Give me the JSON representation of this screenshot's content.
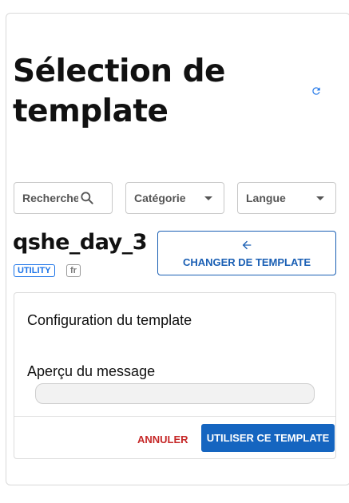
{
  "header": {
    "title": "Sélection de template",
    "refresh_icon": "refresh-icon"
  },
  "filters": {
    "search_placeholder": "Recherche...",
    "search_icon": "search-icon",
    "category_label": "Catégorie",
    "language_label": "Langue"
  },
  "template": {
    "name": "qshe_day_3",
    "category_badge": "UTILITY",
    "language_badge": "fr",
    "change_button_label": "CHANGER DE TEMPLATE",
    "change_button_icon": "arrow-left-icon"
  },
  "config": {
    "title": "Configuration du template",
    "preview_label": "Aperçu du message",
    "preview_text": ""
  },
  "actions": {
    "cancel_label": "ANNULER",
    "use_label": "UTILISER CE TEMPLATE"
  },
  "colors": {
    "primary": "#1565c0",
    "danger": "#c62828",
    "badge_blue": "#1a73e8"
  }
}
